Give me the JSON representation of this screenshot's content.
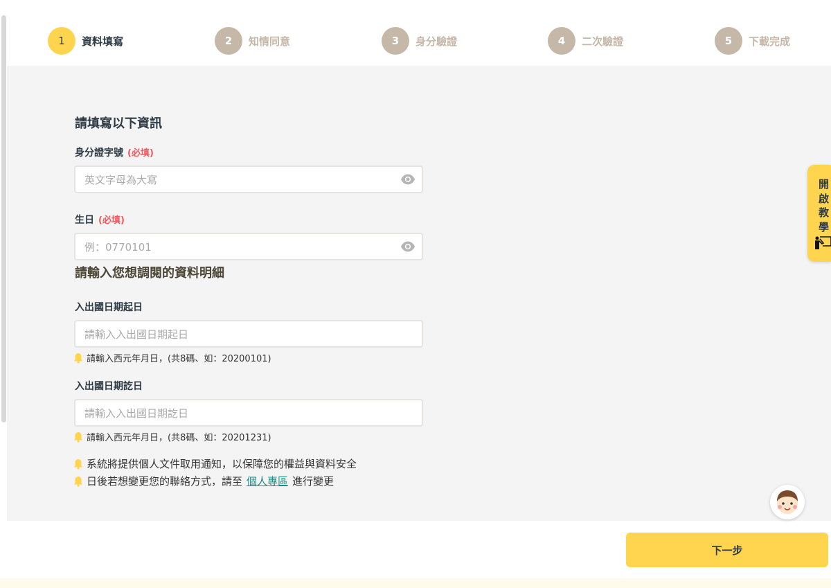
{
  "stepper": [
    {
      "num": "1",
      "label": "資料填寫",
      "active": true
    },
    {
      "num": "2",
      "label": "知情同意"
    },
    {
      "num": "3",
      "label": "身分驗證"
    },
    {
      "num": "4",
      "label": "二次驗證"
    },
    {
      "num": "5",
      "label": "下載完成"
    }
  ],
  "form": {
    "title": "請填寫以下資訊",
    "required": "(必填)",
    "id_label": "身分證字號",
    "id_placeholder": "英文字母為大寫",
    "birth_label": "生日",
    "birth_placeholder": "例：0770101",
    "detail_title": "請輸入您想調閱的資料明細",
    "start_label": "入出國日期起日",
    "start_placeholder": "請輸入入出國日期起日",
    "start_hint": "請輸入西元年月日，(共8碼、如：20200101)",
    "end_label": "入出國日期訖日",
    "end_placeholder": "請輸入入出國日期訖日",
    "end_hint": "請輸入西元年月日，(共8碼、如：20201231)",
    "notice1": "系統將提供個人文件取用通知，以保障您的權益與資料安全",
    "notice2_pre": "日後若想變更您的聯絡方式，請至",
    "notice2_link": "個人專區",
    "notice2_post": "進行變更"
  },
  "tutorial": {
    "label": "開啟教學"
  },
  "next_button": "下一步",
  "colors": {
    "accent": "#ffd44f",
    "inactive": "#c5b8a8",
    "required": "#f0585f",
    "link": "#198c86"
  }
}
